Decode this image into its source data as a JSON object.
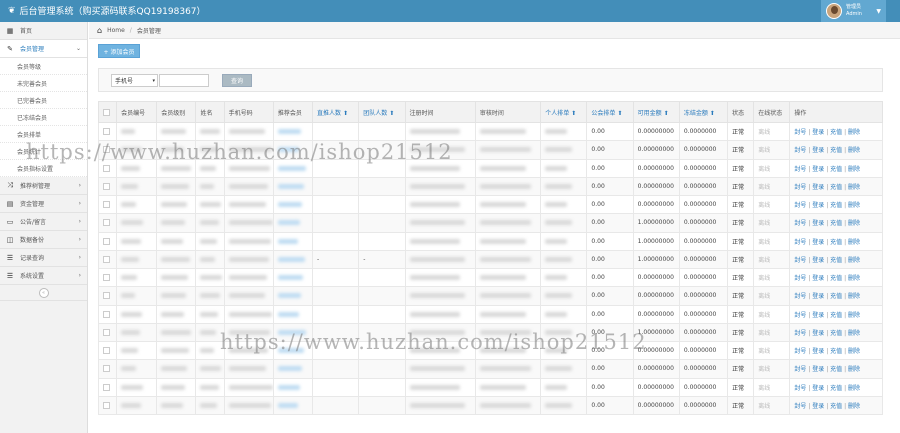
{
  "app": {
    "title": "后台管理系统（购买源码联系QQ19198367）",
    "user_name": "管理员",
    "user_role": "Admin",
    "caret": "▼"
  },
  "sidebar": {
    "items": [
      {
        "label": "首页",
        "icon": "▦",
        "arrow": ""
      },
      {
        "label": "会员管理",
        "icon": "✎",
        "arrow": "⌄"
      }
    ],
    "sub_items": [
      "会员等级",
      "未完善会员",
      "已完善会员",
      "已冻结会员",
      "会员排单",
      "会员统计",
      "会员指标设置"
    ],
    "items_after": [
      {
        "label": "推荐树管理",
        "icon": "⤨",
        "arrow": "›"
      },
      {
        "label": "资金管理",
        "icon": "▤",
        "arrow": "›"
      },
      {
        "label": "公告/留言",
        "icon": "▭",
        "arrow": "›"
      },
      {
        "label": "数据备份",
        "icon": "◫",
        "arrow": "›"
      },
      {
        "label": "记录查询",
        "icon": "☰",
        "arrow": "›"
      },
      {
        "label": "系统设置",
        "icon": "☰",
        "arrow": "›"
      }
    ],
    "collapse": "«"
  },
  "breadcrumb": {
    "home": "Home",
    "current": "会员管理"
  },
  "toolbar": {
    "add_label": "+ 添加会员"
  },
  "filter": {
    "select_value": "手机号",
    "query_label": "查询"
  },
  "table": {
    "headers": [
      {
        "label": "",
        "sortable": false
      },
      {
        "label": "会员编号",
        "sortable": false
      },
      {
        "label": "会员级别",
        "sortable": false
      },
      {
        "label": "姓名",
        "sortable": false
      },
      {
        "label": "手机号码",
        "sortable": false
      },
      {
        "label": "推荐会员",
        "sortable": false
      },
      {
        "label": "直推人数 ⬆",
        "sortable": true
      },
      {
        "label": "团队人数 ⬆",
        "sortable": true
      },
      {
        "label": "注册时间",
        "sortable": false
      },
      {
        "label": "审核时间",
        "sortable": false
      },
      {
        "label": "个人排单 ⬆",
        "sortable": true
      },
      {
        "label": "公会排单 ⬆",
        "sortable": true
      },
      {
        "label": "可用金额 ⬆",
        "sortable": true
      },
      {
        "label": "冻结金额 ⬆",
        "sortable": true
      },
      {
        "label": "状态",
        "sortable": false
      },
      {
        "label": "在线状态",
        "sortable": false
      },
      {
        "label": "操作",
        "sortable": false
      }
    ],
    "rows": [
      {
        "zhitui": "",
        "tuandui": "",
        "gonghui": "0.00",
        "keyong": "0.00000000",
        "dongjie": "0.0000000",
        "status": "正常",
        "online": "离线"
      },
      {
        "zhitui": "",
        "tuandui": "",
        "gonghui": "0.00",
        "keyong": "0.00000000",
        "dongjie": "0.0000000",
        "status": "正常",
        "online": "离线"
      },
      {
        "zhitui": "",
        "tuandui": "",
        "gonghui": "0.00",
        "keyong": "0.00000000",
        "dongjie": "0.0000000",
        "status": "正常",
        "online": "离线"
      },
      {
        "zhitui": "",
        "tuandui": "",
        "gonghui": "0.00",
        "keyong": "0.00000000",
        "dongjie": "0.0000000",
        "status": "正常",
        "online": "离线"
      },
      {
        "zhitui": "",
        "tuandui": "",
        "gonghui": "0.00",
        "keyong": "0.00000000",
        "dongjie": "0.0000000",
        "status": "正常",
        "online": "离线"
      },
      {
        "zhitui": "",
        "tuandui": "",
        "gonghui": "0.00",
        "keyong": "1.00000000",
        "dongjie": "0.0000000",
        "status": "正常",
        "online": "离线"
      },
      {
        "zhitui": "",
        "tuandui": "",
        "gonghui": "0.00",
        "keyong": "1.00000000",
        "dongjie": "0.0000000",
        "status": "正常",
        "online": "离线"
      },
      {
        "zhitui": "-",
        "tuandui": "-",
        "gonghui": "0.00",
        "keyong": "1.00000000",
        "dongjie": "0.0000000",
        "status": "正常",
        "online": "离线"
      },
      {
        "zhitui": "",
        "tuandui": "",
        "gonghui": "0.00",
        "keyong": "0.00000000",
        "dongjie": "0.0000000",
        "status": "正常",
        "online": "离线"
      },
      {
        "zhitui": "",
        "tuandui": "",
        "gonghui": "0.00",
        "keyong": "0.00000000",
        "dongjie": "0.0000000",
        "status": "正常",
        "online": "离线"
      },
      {
        "zhitui": "",
        "tuandui": "",
        "gonghui": "0.00",
        "keyong": "0.00000000",
        "dongjie": "0.0000000",
        "status": "正常",
        "online": "离线"
      },
      {
        "zhitui": "",
        "tuandui": "",
        "gonghui": "0.00",
        "keyong": "1.00000000",
        "dongjie": "0.0000000",
        "status": "正常",
        "online": "离线"
      },
      {
        "zhitui": "",
        "tuandui": "",
        "gonghui": "0.00",
        "keyong": "0.00000000",
        "dongjie": "0.0000000",
        "status": "正常",
        "online": "离线"
      },
      {
        "zhitui": "",
        "tuandui": "",
        "gonghui": "0.00",
        "keyong": "0.00000000",
        "dongjie": "0.0000000",
        "status": "正常",
        "online": "离线"
      },
      {
        "zhitui": "",
        "tuandui": "",
        "gonghui": "0.00",
        "keyong": "0.00000000",
        "dongjie": "0.0000000",
        "status": "正常",
        "online": "离线"
      },
      {
        "zhitui": "",
        "tuandui": "",
        "gonghui": "0.00",
        "keyong": "0.00000000",
        "dongjie": "0.0000000",
        "status": "正常",
        "online": "离线"
      }
    ],
    "actions": [
      "封号",
      "登录",
      "充值",
      "删除"
    ]
  },
  "watermarks": [
    "https://www.huzhan.com/ishop21512",
    "https://www.huzhan.com/ishop21512"
  ],
  "colors": {
    "topbar": "#438eb9",
    "link": "#2a7bbd",
    "add_button": "#6fb3e0",
    "query_button": "#abbac3"
  }
}
